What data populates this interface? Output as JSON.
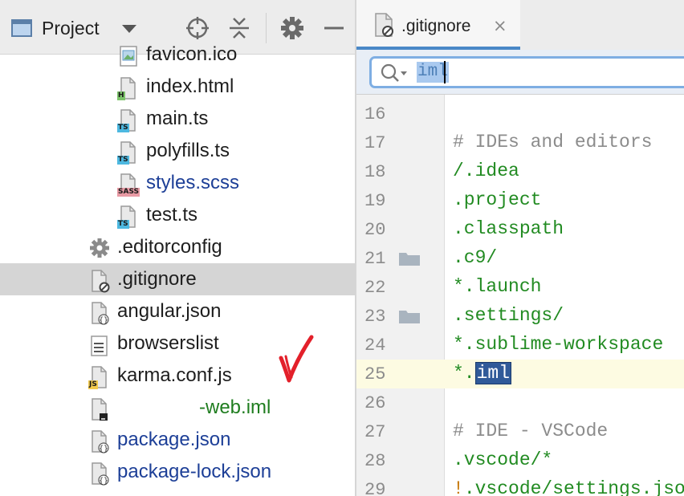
{
  "project_panel": {
    "title": "Project",
    "tree": [
      {
        "label": "favicon.ico",
        "icon": "image-file-icon",
        "color": "normal"
      },
      {
        "label": "index.html",
        "icon": "html-file-icon",
        "badge": "H",
        "badge_color": "#7cc46a",
        "color": "normal"
      },
      {
        "label": "main.ts",
        "icon": "typescript-file-icon",
        "badge": "TS",
        "badge_color": "#4db8e0",
        "color": "normal"
      },
      {
        "label": "polyfills.ts",
        "icon": "typescript-file-icon",
        "badge": "TS",
        "badge_color": "#4db8e0",
        "color": "normal"
      },
      {
        "label": "styles.scss",
        "icon": "sass-file-icon",
        "badge": "SASS",
        "badge_color": "#e89aa4",
        "color": "blue"
      },
      {
        "label": "test.ts",
        "icon": "typescript-file-icon",
        "badge": "TS",
        "badge_color": "#4db8e0",
        "color": "normal"
      },
      {
        "label": ".editorconfig",
        "icon": "gear-file-icon",
        "color": "normal"
      },
      {
        "label": ".gitignore",
        "icon": "ignore-file-icon",
        "color": "normal",
        "selected": true
      },
      {
        "label": "angular.json",
        "icon": "json-file-icon",
        "color": "normal"
      },
      {
        "label": "browserslist",
        "icon": "text-file-icon",
        "color": "normal"
      },
      {
        "label": "karma.conf.js",
        "icon": "javascript-file-icon",
        "badge": "JS",
        "badge_color": "#f2c94c",
        "color": "normal"
      },
      {
        "label": "-web.iml",
        "icon": "iml-file-icon",
        "color": "green"
      },
      {
        "label": "package.json",
        "icon": "json-file-icon",
        "color": "blue"
      },
      {
        "label": "package-lock.json",
        "icon": "json-file-icon",
        "color": "blue"
      }
    ]
  },
  "editor": {
    "tab": {
      "label": ".gitignore",
      "close": "×"
    },
    "search": {
      "query": "iml"
    },
    "lines": [
      {
        "num": "16",
        "text": "",
        "kind": "plain"
      },
      {
        "num": "17",
        "text": "# IDEs and editors",
        "kind": "comment"
      },
      {
        "num": "18",
        "text": "/.idea",
        "kind": "green"
      },
      {
        "num": "19",
        "text": ".project",
        "kind": "green"
      },
      {
        "num": "20",
        "text": ".classpath",
        "kind": "green"
      },
      {
        "num": "21",
        "text": ".c9/",
        "kind": "green",
        "fold": true
      },
      {
        "num": "22",
        "text": "*.launch",
        "kind": "green"
      },
      {
        "num": "23",
        "text": ".settings/",
        "kind": "green",
        "fold": true
      },
      {
        "num": "24",
        "text": "*.sublime-workspace",
        "kind": "green"
      },
      {
        "num": "25",
        "text": "*.iml",
        "kind": "green",
        "current": true,
        "highlight": "iml"
      },
      {
        "num": "26",
        "text": "",
        "kind": "plain"
      },
      {
        "num": "27",
        "text": "# IDE - VSCode",
        "kind": "comment"
      },
      {
        "num": "28",
        "text": ".vscode/*",
        "kind": "green"
      },
      {
        "num": "29",
        "text": "!.vscode/settings.json",
        "kind": "negate"
      }
    ]
  },
  "colors": {
    "selection_row": "#d5d5d5",
    "tab_underline": "#4a88c7",
    "search_border": "#7eaee3",
    "match_highlight": "#305a99",
    "annotation_checkmark": "#e3202a"
  }
}
